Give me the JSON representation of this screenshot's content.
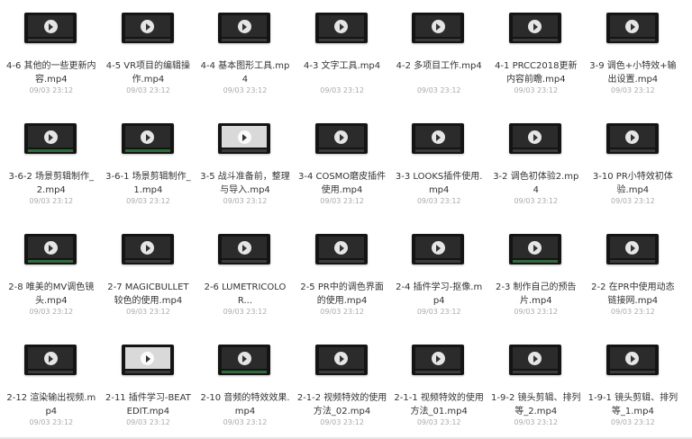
{
  "files": [
    {
      "title": "4-6 其他的一些更新内容.mp4",
      "date": "09/03 23:12",
      "screen": "dark",
      "bar": "dark"
    },
    {
      "title": "4-5 VR项目的编辑操作.mp4",
      "date": "09/03 23:12",
      "screen": "dark",
      "bar": "dark"
    },
    {
      "title": "4-4 基本图形工具.mp4",
      "date": "09/03 23:12",
      "screen": "dark",
      "bar": "dark"
    },
    {
      "title": "4-3 文字工具.mp4",
      "date": "09/03 23:12",
      "screen": "dark",
      "bar": "dark"
    },
    {
      "title": "4-2 多项目工作.mp4",
      "date": "09/03 23:12",
      "screen": "dark",
      "bar": "dark"
    },
    {
      "title": "4-1 PRCC2018更新内容前瞻.mp4",
      "date": "09/03 23:12",
      "screen": "dark",
      "bar": "dark"
    },
    {
      "title": "3-9 调色+小特效+输出设置.mp4",
      "date": "09/03 23:12",
      "screen": "dark",
      "bar": "dark"
    },
    {
      "title": "3-6-2 场景剪辑制作_2.mp4",
      "date": "09/03 23:12",
      "screen": "dark",
      "bar": "green"
    },
    {
      "title": "3-6-1 场景剪辑制作_1.mp4",
      "date": "09/03 23:12",
      "screen": "dark",
      "bar": "green"
    },
    {
      "title": "3-5 战斗准备前，整理与导入.mp4",
      "date": "09/03 23:12",
      "screen": "light",
      "bar": "dark"
    },
    {
      "title": "3-4 COSMO磨皮插件使用.mp4",
      "date": "09/03 23:12",
      "screen": "dark",
      "bar": "dark"
    },
    {
      "title": "3-3 LOOKS插件使用.mp4",
      "date": "09/03 23:12",
      "screen": "dark",
      "bar": "dark"
    },
    {
      "title": "3-2 调色初体验2.mp4",
      "date": "09/03 23:12",
      "screen": "dark",
      "bar": "dark"
    },
    {
      "title": "3-10 PR小特效初体验.mp4",
      "date": "09/03 23:12",
      "screen": "dark",
      "bar": "dark"
    },
    {
      "title": "2-8 唯美的MV调色镜头.mp4",
      "date": "09/03 23:12",
      "screen": "dark",
      "bar": "green"
    },
    {
      "title": "2-7 MAGICBULLET较色的使用.mp4",
      "date": "09/03 23:12",
      "screen": "dark",
      "bar": "dark"
    },
    {
      "title": "2-6 LUMETRICOLOR...",
      "date": "09/03 23:12",
      "screen": "dark",
      "bar": "dark"
    },
    {
      "title": "2-5 PR中的调色界面的使用.mp4",
      "date": "09/03 23:12",
      "screen": "dark",
      "bar": "dark"
    },
    {
      "title": "2-4 插件学习-抠像.mp4",
      "date": "09/03 23:12",
      "screen": "dark",
      "bar": "dark"
    },
    {
      "title": "2-3 制作自己的预告片.mp4",
      "date": "09/03 23:12",
      "screen": "dark",
      "bar": "green"
    },
    {
      "title": "2-2 在PR中使用动态链接网.mp4",
      "date": "09/03 23:12",
      "screen": "dark",
      "bar": "dark"
    },
    {
      "title": "2-12 渲染输出视频.mp4",
      "date": "09/03 23:12",
      "screen": "dark",
      "bar": "dark"
    },
    {
      "title": "2-11 插件学习-BEATEDIT.mp4",
      "date": "09/03 23:12",
      "screen": "light",
      "bar": "dark"
    },
    {
      "title": "2-10 音频的特效效果.mp4",
      "date": "09/03 23:12",
      "screen": "dark",
      "bar": "green"
    },
    {
      "title": "2-1-2 视频特效的使用方法_02.mp4",
      "date": "09/03 23:12",
      "screen": "dark",
      "bar": "dark"
    },
    {
      "title": "2-1-1 视频特效的使用方法_01.mp4",
      "date": "09/03 23:12",
      "screen": "dark",
      "bar": "dark"
    },
    {
      "title": "1-9-2 镜头剪辑、排列等_2.mp4",
      "date": "09/03 23:12",
      "screen": "dark",
      "bar": "dark"
    },
    {
      "title": "1-9-1 镜头剪辑、排列等_1.mp4",
      "date": "09/03 23:12",
      "screen": "dark",
      "bar": "dark"
    }
  ]
}
